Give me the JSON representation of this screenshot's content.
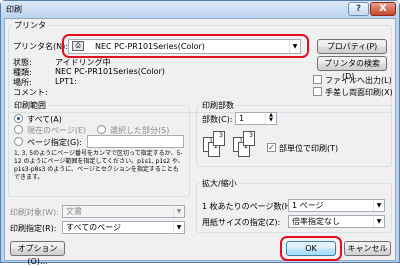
{
  "window": {
    "title": "印刷",
    "help_glyph": "?",
    "close_glyph": "X"
  },
  "printer_group": {
    "legend": "プリンタ",
    "name_label": "プリンタ名(N):",
    "name_value": "NEC PC-PR101Series(Color)",
    "properties_button": "プロパティ(P)",
    "find_printer_button": "プリンタの検索(D)...",
    "status_label": "状態:",
    "status_value": "アイドリング中",
    "type_label": "種類:",
    "type_value": "NEC PC-PR101Series(Color)",
    "where_label": "場所:",
    "where_value": "LPT1:",
    "comment_label": "コメント:",
    "print_to_file": "ファイルへ出力(L)",
    "manual_duplex": "手差し両面印刷(X)"
  },
  "page_range": {
    "legend": "印刷範囲",
    "all": "すべて(A)",
    "current_page": "現在のページ(E)",
    "selection": "選択した部分(S)",
    "pages": "ページ指定(G):",
    "pages_value": "",
    "hint": "1, 3, 5のようにページ番号をカンマで区切って指定するか、5-12 のようにページ範囲を指定してください。p1s1, p1s2 や、p1s3-p8s3 のように、ページとセクションを指定することもできます。"
  },
  "copies": {
    "legend": "印刷部数",
    "count_label": "部数(C):",
    "count_value": "1",
    "collate": "部単位で印刷(T)"
  },
  "print_what": {
    "label": "印刷対象(W):",
    "value": "文書"
  },
  "print_select": {
    "label": "印刷指定(R):",
    "value": "すべてのページ"
  },
  "zoom": {
    "legend": "拡大/縮小",
    "pages_per_sheet_label": "1 枚あたりのページ数(H):",
    "pages_per_sheet_value": "1 ページ",
    "scale_label": "用紙サイズの指定(Z):",
    "scale_value": "倍率指定なし"
  },
  "buttons": {
    "options": "オプション(O)...",
    "ok": "OK",
    "cancel": "キャンセル"
  },
  "colors": {
    "highlight_ring": "#e01020"
  }
}
